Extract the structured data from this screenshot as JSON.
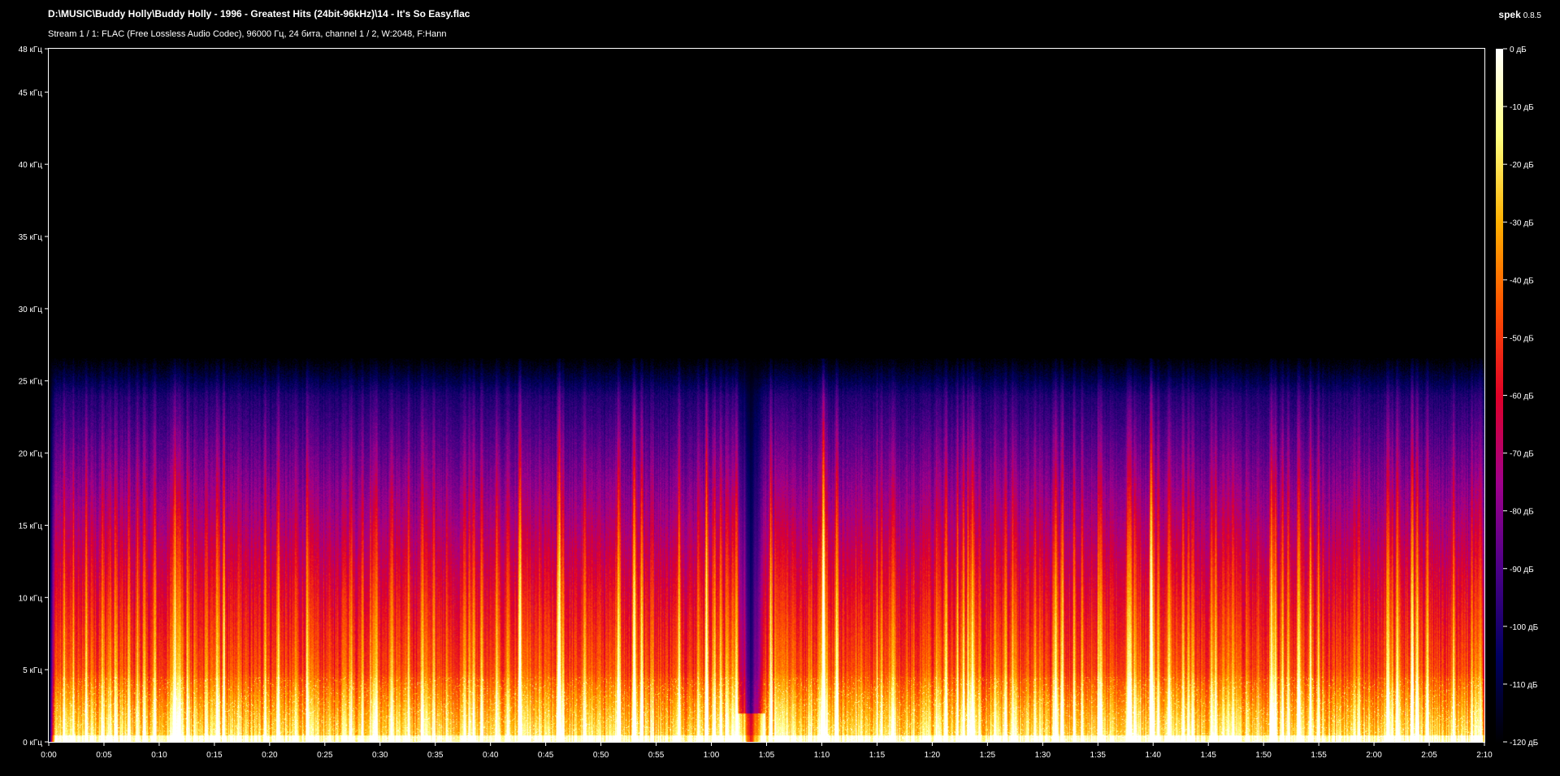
{
  "header": {
    "file_path": "D:\\MUSIC\\Buddy Holly\\Buddy Holly - 1996 - Greatest Hits (24bit-96kHz)\\14 - It's So Easy.flac",
    "stream_info": "Stream 1 / 1: FLAC (Free Lossless Audio Codec), 96000 Гц, 24 бита, channel 1 / 2, W:2048, F:Hann",
    "app_name": "spek",
    "app_version": "0.8.5"
  },
  "chart_data": {
    "type": "heatmap",
    "title": "",
    "xlabel": "",
    "ylabel": "",
    "x_range_seconds": [
      0,
      130
    ],
    "y_range_khz": [
      0,
      48
    ],
    "x_ticks": [
      "0:00",
      "0:05",
      "0:10",
      "0:15",
      "0:20",
      "0:25",
      "0:30",
      "0:35",
      "0:40",
      "0:45",
      "0:50",
      "0:55",
      "1:00",
      "1:05",
      "1:10",
      "1:15",
      "1:20",
      "1:25",
      "1:30",
      "1:35",
      "1:40",
      "1:45",
      "1:50",
      "1:55",
      "2:00",
      "2:05",
      "2:10"
    ],
    "y_ticks": [
      "0 кГц",
      "5 кГц",
      "10 кГц",
      "15 кГц",
      "20 кГц",
      "25 кГц",
      "30 кГц",
      "35 кГц",
      "40 кГц",
      "45 кГц",
      "48 кГц"
    ],
    "colorbar_ticks": [
      "0 дБ",
      "-10 дБ",
      "-20 дБ",
      "-30 дБ",
      "-40 дБ",
      "-50 дБ",
      "-60 дБ",
      "-70 дБ",
      "-80 дБ",
      "-90 дБ",
      "-100 дБ",
      "-110 дБ",
      "-120 дБ"
    ],
    "db_range": [
      -120,
      0
    ],
    "content_cutoff_khz": 26,
    "quiet_gap_seconds": 63.5,
    "colormap": [
      "#000000",
      "#000060",
      "#4b0088",
      "#a0008c",
      "#e00028",
      "#ff5000",
      "#ffb000",
      "#ffff80",
      "#ffffff"
    ]
  }
}
